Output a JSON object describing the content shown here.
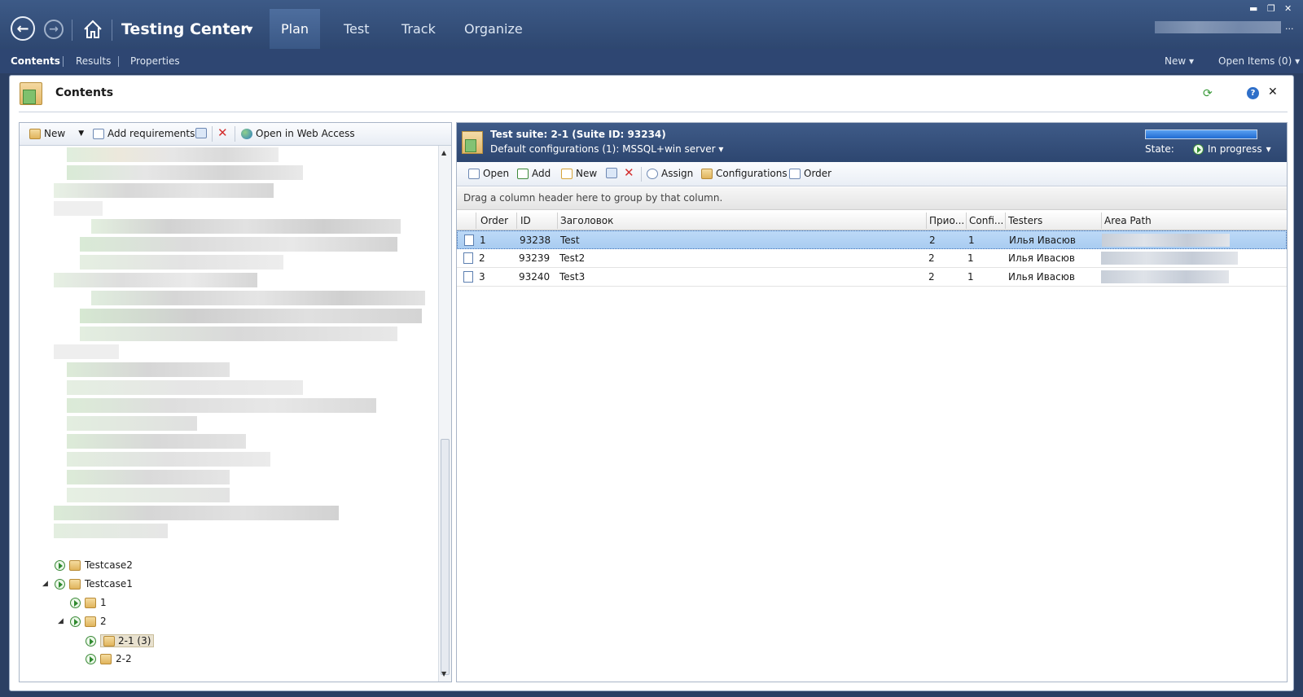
{
  "window": {
    "controls": [
      "minimize-icon",
      "restore-icon",
      "close-icon"
    ]
  },
  "topbar": {
    "app_title": "Testing Center",
    "tabs": [
      {
        "label": "Plan",
        "active": true
      },
      {
        "label": "Test"
      },
      {
        "label": "Track"
      },
      {
        "label": "Organize"
      }
    ],
    "user_suffix": "..."
  },
  "subbar": {
    "items": [
      {
        "label": "Contents",
        "active": true
      },
      {
        "label": "Results"
      },
      {
        "label": "Properties"
      }
    ],
    "new_label": "New",
    "open_items_label": "Open Items (0)"
  },
  "panel": {
    "title": "Contents"
  },
  "left": {
    "toolbar": {
      "new_label": "New",
      "add_requirements_label": "Add requirements",
      "open_web_label": "Open in Web Access"
    },
    "tree": [
      {
        "label": "Testcase2",
        "level": 0,
        "expander": ""
      },
      {
        "label": "Testcase1",
        "level": 0,
        "expander": "◢"
      },
      {
        "label": "1",
        "level": 1,
        "expander": ""
      },
      {
        "label": "2",
        "level": 1,
        "expander": "◢"
      },
      {
        "label": "2-1 (3)",
        "level": 2,
        "expander": "",
        "selected": true
      },
      {
        "label": "2-2",
        "level": 2,
        "expander": ""
      }
    ]
  },
  "suite": {
    "title": "Test suite:  2-1 (Suite ID: 93234)",
    "default_config": "Default configurations (1):   MSSQL+win server",
    "state_label": "State:",
    "state_value": "In progress",
    "progress": 1.0
  },
  "right_toolbar": {
    "open": "Open",
    "add": "Add",
    "new": "New",
    "assign": "Assign",
    "configurations": "Configurations",
    "order": "Order"
  },
  "grid": {
    "group_hint": "Drag a column header here to group by that column.",
    "columns": [
      "Order",
      "ID",
      "Заголовок",
      "Прио...",
      "Confi...",
      "Testers",
      "Area Path"
    ],
    "rows": [
      {
        "order": "1",
        "id": "93238",
        "title": "Test",
        "priority": "2",
        "config": "1",
        "testers": "Илья Ивасюв",
        "selected": true
      },
      {
        "order": "2",
        "id": "93239",
        "title": "Test2",
        "priority": "2",
        "config": "1",
        "testers": "Илья Ивасюв"
      },
      {
        "order": "3",
        "id": "93240",
        "title": "Test3",
        "priority": "2",
        "config": "1",
        "testers": "Илья Ивасюв"
      }
    ]
  }
}
